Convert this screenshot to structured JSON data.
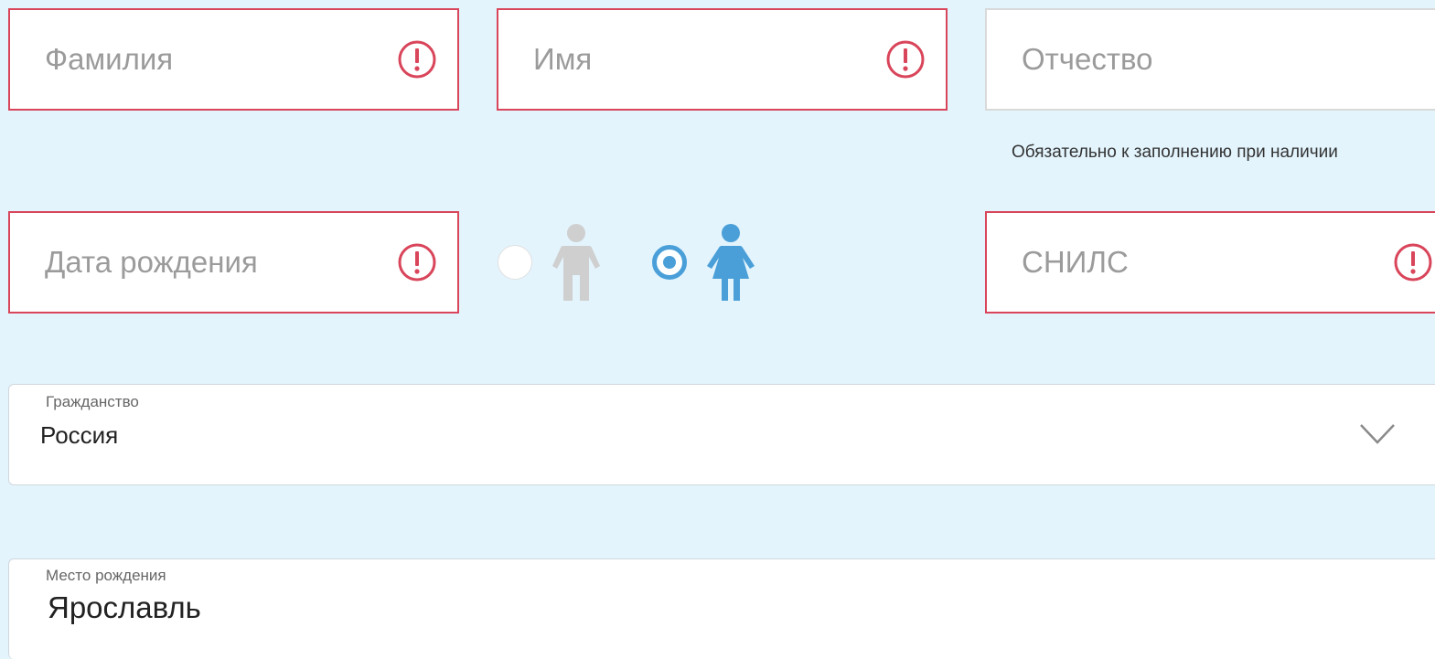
{
  "fields": {
    "last_name": {
      "placeholder": "Фамилия",
      "value": ""
    },
    "first_name": {
      "placeholder": "Имя",
      "value": ""
    },
    "patronymic": {
      "placeholder": "Отчество",
      "value": "",
      "hint": "Обязательно к заполнению при наличии"
    },
    "birth_date": {
      "placeholder": "Дата рождения",
      "value": ""
    },
    "snils": {
      "placeholder": "СНИЛС",
      "value": ""
    }
  },
  "gender": {
    "options": [
      "male",
      "female"
    ],
    "selected": "female"
  },
  "citizenship": {
    "label": "Гражданство",
    "value": "Россия"
  },
  "birth_place": {
    "label": "Место рождения",
    "value": "Ярославль"
  },
  "colors": {
    "background": "#e3f4fd",
    "error": "#d9455a",
    "accent": "#4a9fd8",
    "inactive_icon": "#cfcfcf"
  },
  "icons": {
    "error": "exclamation-circle-icon",
    "male": "male-person-icon",
    "female": "female-person-icon",
    "dropdown": "chevron-down-icon"
  }
}
